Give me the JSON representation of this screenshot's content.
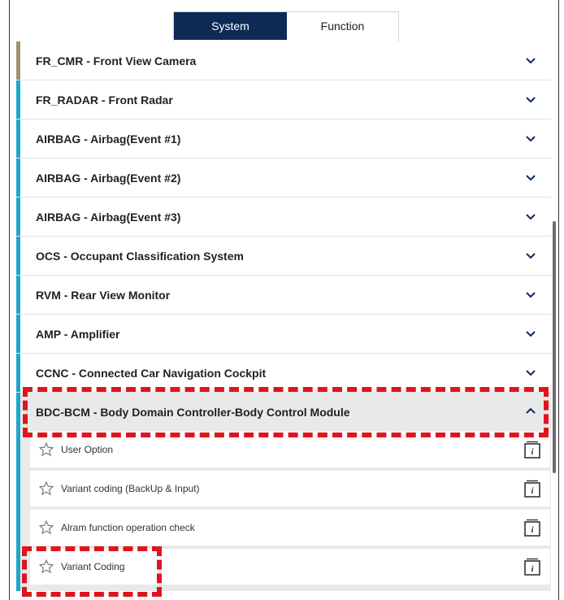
{
  "tabs": [
    {
      "label": "System",
      "active": true
    },
    {
      "label": "Function",
      "active": false
    }
  ],
  "systems": [
    {
      "label": "FR_CMR - Front View Camera",
      "accent": "#a28f73"
    },
    {
      "label": "FR_RADAR - Front Radar",
      "accent": "#1ea7c9"
    },
    {
      "label": "AIRBAG - Airbag(Event #1)",
      "accent": "#1ea7c9"
    },
    {
      "label": "AIRBAG - Airbag(Event #2)",
      "accent": "#1ea7c9"
    },
    {
      "label": "AIRBAG - Airbag(Event #3)",
      "accent": "#1ea7c9"
    },
    {
      "label": "OCS - Occupant Classification System",
      "accent": "#1ea7c9"
    },
    {
      "label": "RVM - Rear View Monitor",
      "accent": "#1ea7c9"
    },
    {
      "label": "AMP - Amplifier",
      "accent": "#1ea7c9"
    },
    {
      "label": "CCNC - Connected Car Navigation Cockpit",
      "accent": "#1ea7c9"
    }
  ],
  "expanded_system": {
    "label": "BDC-BCM - Body Domain Controller-Body Control Module",
    "items": [
      {
        "label": "User Option",
        "icon": "star-outline-icon",
        "action_icon": "info-icon"
      },
      {
        "label": "Variant coding (BackUp & Input)",
        "icon": "star-outline-icon",
        "action_icon": "info-icon"
      },
      {
        "label": "Alram function operation check",
        "icon": "star-outline-icon",
        "action_icon": "info-icon"
      },
      {
        "label": "Variant Coding",
        "icon": "star-outline-icon",
        "action_icon": "info-icon"
      }
    ]
  },
  "colors": {
    "active_tab": "#0c2a55",
    "accent_bar": "#1ea7c9",
    "highlight": "#e0141c"
  }
}
